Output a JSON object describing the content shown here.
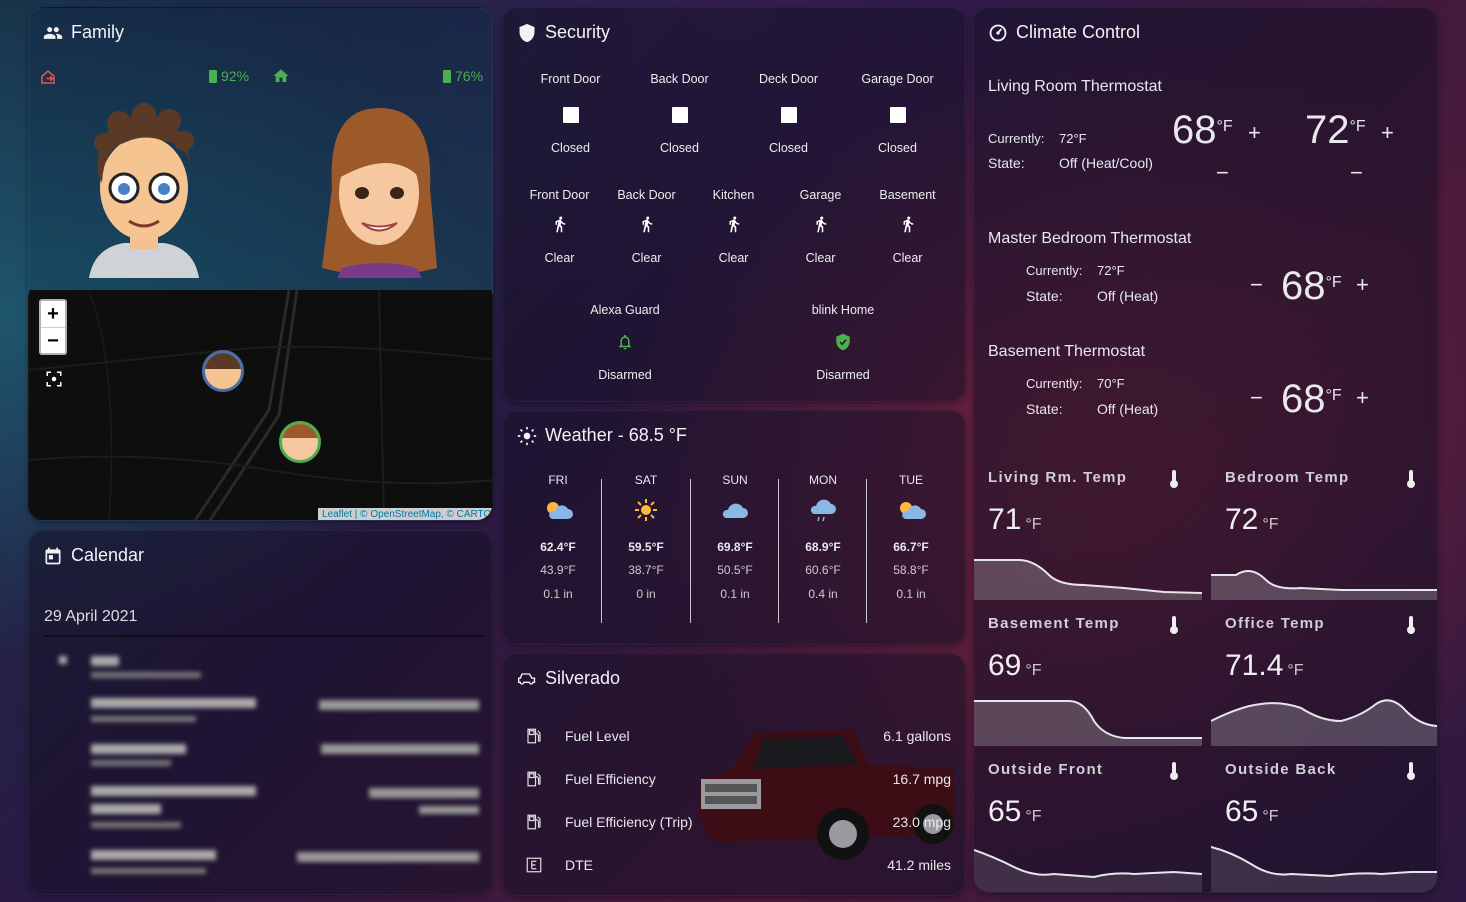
{
  "family": {
    "title": "Family",
    "battery1": "92%",
    "battery2": "76%",
    "map_attribution": "Leaflet | © OpenStreetMap, © CARTO",
    "zoom_in": "+",
    "zoom_out": "−"
  },
  "calendar": {
    "title": "Calendar",
    "date": "29 April 2021"
  },
  "security": {
    "title": "Security",
    "doors": [
      {
        "label": "Front Door",
        "state": "Closed"
      },
      {
        "label": "Back Door",
        "state": "Closed"
      },
      {
        "label": "Deck Door",
        "state": "Closed"
      },
      {
        "label": "Garage Door",
        "state": "Closed"
      }
    ],
    "motion": [
      {
        "label": "Front Door",
        "state": "Clear"
      },
      {
        "label": "Back Door",
        "state": "Clear"
      },
      {
        "label": "Kitchen",
        "state": "Clear"
      },
      {
        "label": "Garage",
        "state": "Clear"
      },
      {
        "label": "Basement",
        "state": "Clear"
      }
    ],
    "alarms": [
      {
        "label": "Alexa Guard",
        "state": "Disarmed"
      },
      {
        "label": "blink Home",
        "state": "Disarmed"
      }
    ]
  },
  "weather": {
    "title": "Weather - 68.5 °F",
    "days": [
      {
        "day": "FRI",
        "high": "62.4°F",
        "low": "43.9°F",
        "precip": "0.1 in",
        "icon": "partly-cloudy-icon"
      },
      {
        "day": "SAT",
        "high": "59.5°F",
        "low": "38.7°F",
        "precip": "0 in",
        "icon": "sunny-icon"
      },
      {
        "day": "SUN",
        "high": "69.8°F",
        "low": "50.5°F",
        "precip": "0.1 in",
        "icon": "cloudy-icon"
      },
      {
        "day": "MON",
        "high": "68.9°F",
        "low": "60.6°F",
        "precip": "0.4 in",
        "icon": "rain-icon"
      },
      {
        "day": "TUE",
        "high": "66.7°F",
        "low": "58.8°F",
        "precip": "0.1 in",
        "icon": "partly-cloudy-icon"
      }
    ]
  },
  "silverado": {
    "title": "Silverado",
    "rows": [
      {
        "label": "Fuel Level",
        "value": "6.1 gallons"
      },
      {
        "label": "Fuel Efficiency",
        "value": "16.7 mpg"
      },
      {
        "label": "Fuel Efficiency (Trip)",
        "value": "23.0 mpg"
      },
      {
        "label": "DTE",
        "value": "41.2 miles"
      }
    ]
  },
  "climate": {
    "title": "Climate Control",
    "living": {
      "name": "Living Room Thermostat",
      "currently_label": "Currently:",
      "currently": "72°F",
      "state_label": "State:",
      "state": "Off (Heat/Cool)",
      "low": "68",
      "high": "72",
      "unit": "°F"
    },
    "master": {
      "name": "Master Bedroom Thermostat",
      "currently_label": "Currently:",
      "currently": "72°F",
      "state_label": "State:",
      "state": "Off (Heat)",
      "target": "68",
      "unit": "°F"
    },
    "basement": {
      "name": "Basement Thermostat",
      "currently_label": "Currently:",
      "currently": "70°F",
      "state_label": "State:",
      "state": "Off (Heat)",
      "target": "68",
      "unit": "°F"
    },
    "temps": [
      {
        "name": "Living Rm. Temp",
        "value": "71",
        "unit": "°F"
      },
      {
        "name": "Bedroom Temp",
        "value": "72",
        "unit": "°F"
      },
      {
        "name": "Basement Temp",
        "value": "69",
        "unit": "°F"
      },
      {
        "name": "Office Temp",
        "value": "71.4",
        "unit": "°F"
      },
      {
        "name": "Outside Front",
        "value": "65",
        "unit": "°F"
      },
      {
        "name": "Outside Back",
        "value": "65",
        "unit": "°F"
      }
    ]
  },
  "colors": {
    "green": "#4caf50",
    "red": "#e05555",
    "accent": "#ffffff"
  }
}
